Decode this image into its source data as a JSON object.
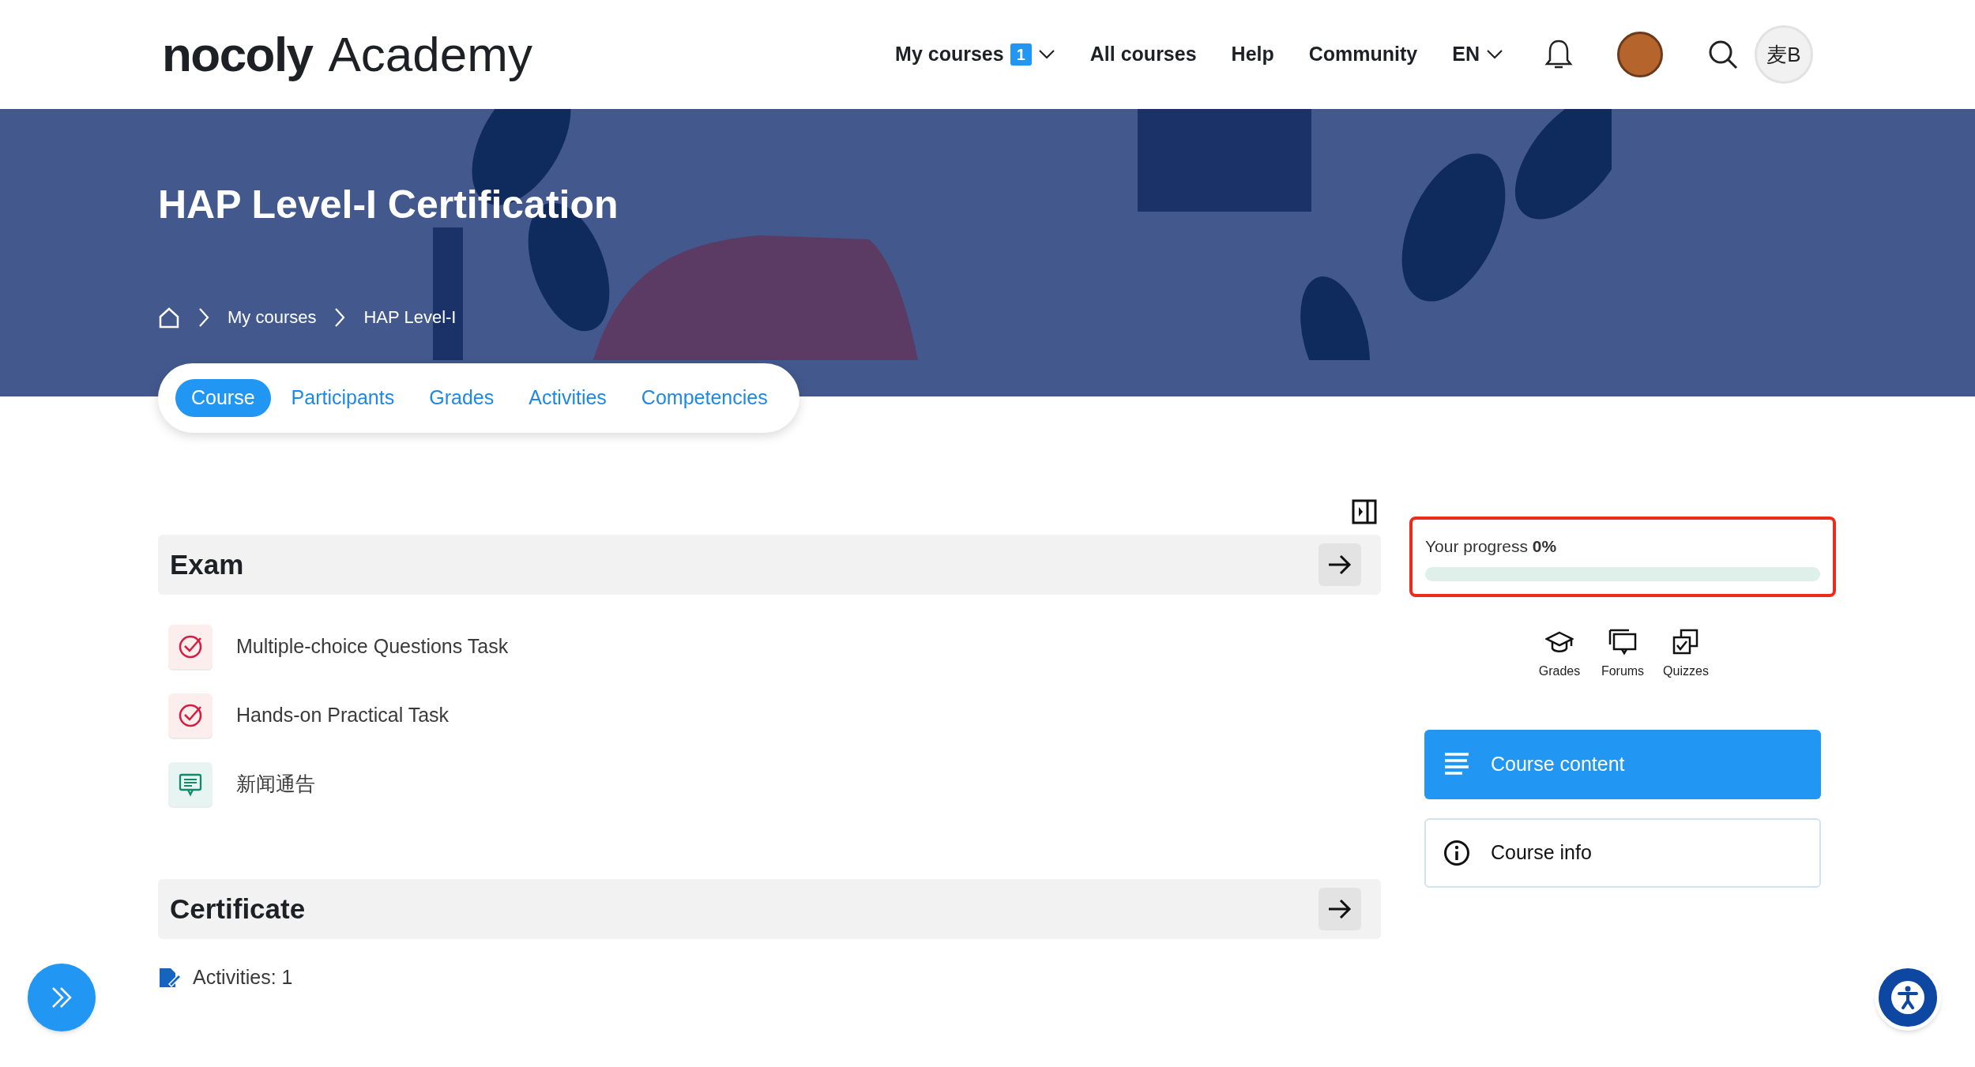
{
  "header": {
    "logo": {
      "brand": "nocoly",
      "product": "Academy"
    },
    "nav": [
      {
        "kind": "menu",
        "label": "My courses",
        "badge": "1"
      },
      {
        "kind": "link",
        "label": "All courses"
      },
      {
        "kind": "link",
        "label": "Help"
      },
      {
        "kind": "link",
        "label": "Community"
      },
      {
        "kind": "menu",
        "label": "EN"
      }
    ],
    "user_initials": "麦B"
  },
  "course": {
    "title": "HAP Level-I Certification",
    "breadcrumb": [
      "My courses",
      "HAP Level-I"
    ]
  },
  "tabs": [
    {
      "label": "Course",
      "selected": true
    },
    {
      "label": "Participants",
      "selected": false
    },
    {
      "label": "Grades",
      "selected": false
    },
    {
      "label": "Activities",
      "selected": false
    },
    {
      "label": "Competencies",
      "selected": false
    }
  ],
  "sections": [
    {
      "title": "Exam",
      "activities": [
        {
          "kind": "assignment",
          "title": "Multiple-choice Questions Task"
        },
        {
          "kind": "assignment",
          "title": "Hands-on Practical Task"
        },
        {
          "kind": "forum",
          "title": "新闻通告"
        }
      ]
    },
    {
      "title": "Certificate",
      "summary": "Activities: 1"
    }
  ],
  "progress": {
    "label": "Your progress **0%**",
    "level": 0
  },
  "shortcuts": [
    {
      "kind": "grades",
      "label": "Grades"
    },
    {
      "kind": "forums",
      "label": "Forums"
    },
    {
      "kind": "quizzes",
      "label": "Quizzes"
    }
  ],
  "side_buttons": [
    {
      "kind": "content",
      "label": "Course content",
      "selected": true
    },
    {
      "kind": "info",
      "label": "Course info",
      "selected": false
    }
  ]
}
